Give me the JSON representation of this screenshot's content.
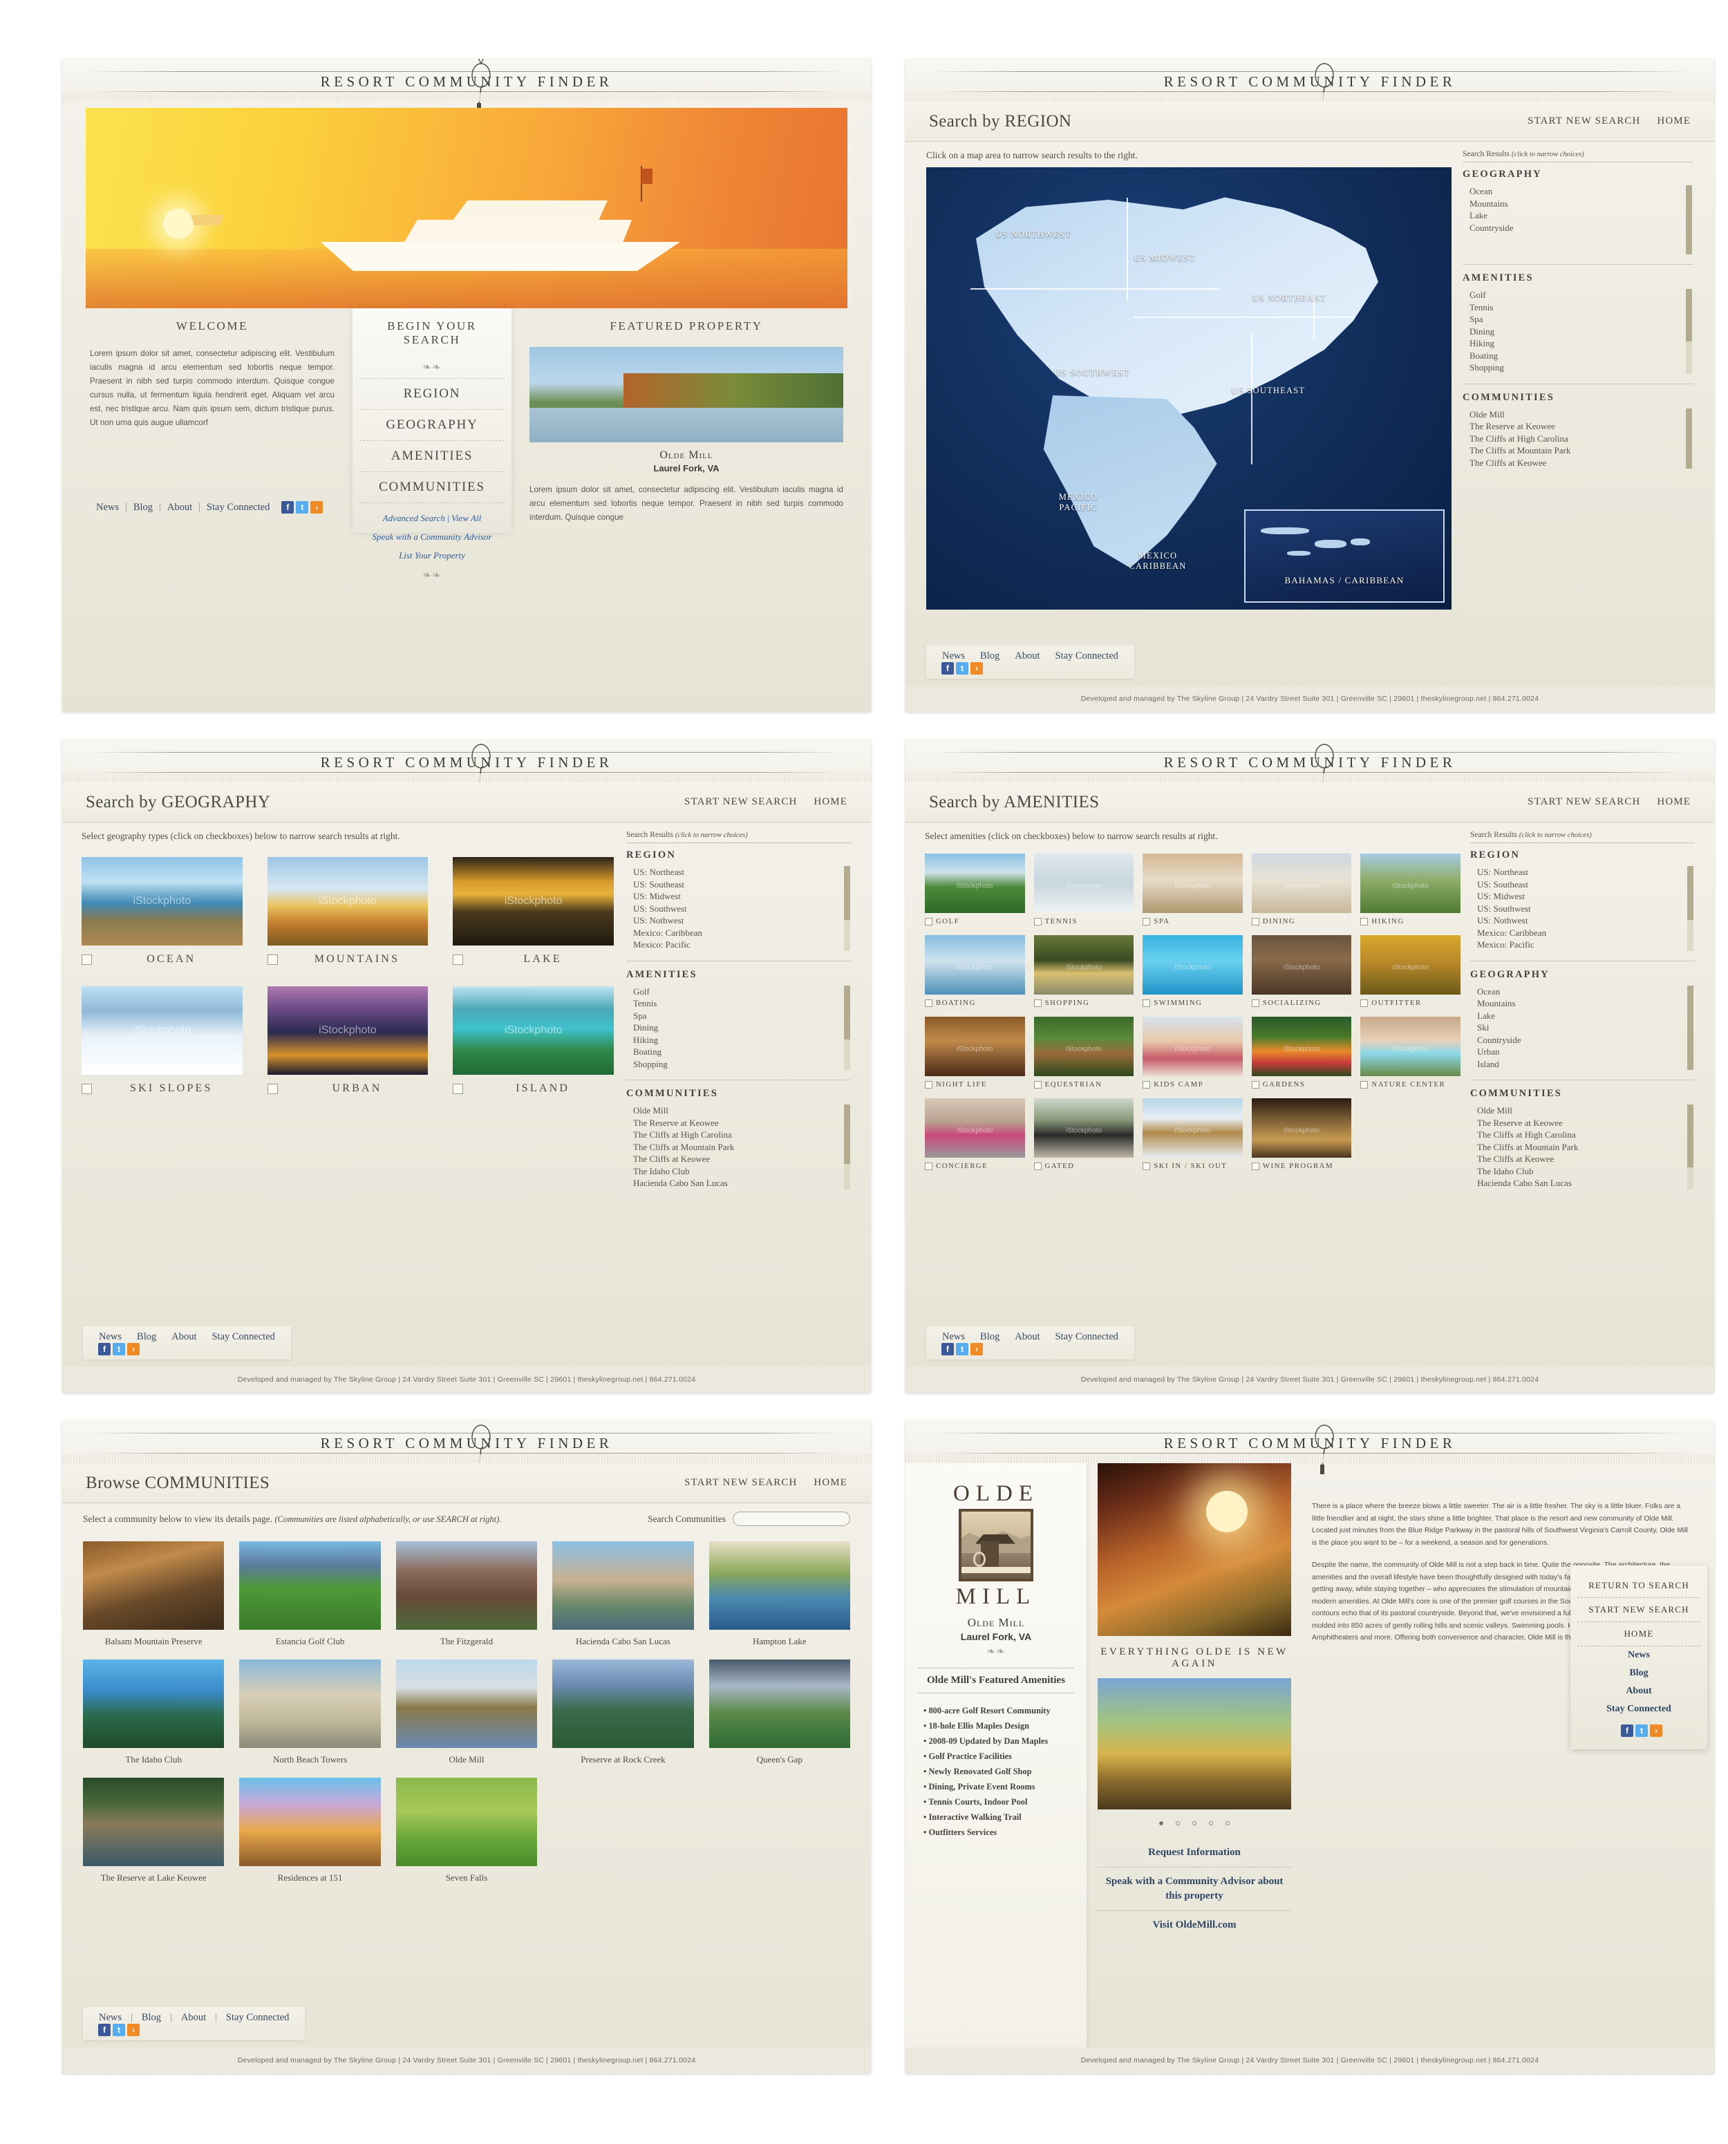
{
  "brand": {
    "title": "RESORT COMMUNITY FINDER"
  },
  "footer": {
    "credit": "Developed and managed by The Skyline Group  |  24 Vardry Street  Suite 301  |  Greenville  SC   |  29601  |  theskylinegroup.net  |  864.271.0024"
  },
  "footlinks": {
    "news": "News",
    "blog": "Blog",
    "about": "About",
    "stay": "Stay Connected",
    "sep": "|"
  },
  "home": {
    "welcome_title": "WELCOME",
    "welcome_text": "Lorem ipsum dolor sit amet, consectetur adipiscing elit. Vestibulum iaculis magna id arcu elementum sed lobortis neque tempor. Praesent in nibh sed turpis commodo interdum. Quisque congue cursus nulla, ut fermentum ligula hendrerit eget. Aliquam vel arcu est, nec tristique arcu. Nam quis ipsum sem, dictum tristique purus. Ut non urna quis augue ullamcorf",
    "search_title": "BEGIN YOUR SEARCH",
    "menu": [
      "REGION",
      "GEOGRAPHY",
      "AMENITIES",
      "COMMUNITIES"
    ],
    "advanced_search": "Advanced Search",
    "view_all": "View All",
    "link_sep": "|",
    "speak": "Speak with a Community Advisor",
    "list_property": "List Your Property",
    "feature_title": "FEATURED PROPERTY",
    "feature_name": "Olde Mill",
    "feature_loc": "Laurel Fork, VA",
    "feature_text": "Lorem ipsum dolor sit amet, consectetur adipiscing elit. Vestibulum iaculis magna id arcu elementum sed lobortis neque tempor. Praesent in nibh sed turpis commodo interdum. Quisque congue"
  },
  "region": {
    "page_title": "Search by REGION",
    "start_new": "START NEW SEARCH",
    "home": "HOME",
    "instruction": "Click on a map area to narrow search results to the right.",
    "results_label": "Search Results",
    "results_hint": "(click to narrow choices)",
    "map_labels": [
      "US NORTHWEST",
      "US MIDWEST",
      "US NORTHEAST",
      "US SOUTHWEST",
      "US SOUTHEAST",
      "MEXICO\nPACIFIC",
      "MEXICO\nCARIBBEAN"
    ],
    "inset_label": "BAHAMAS / CARIBBEAN",
    "sidebar": [
      {
        "title": "GEOGRAPHY",
        "items": [
          "Ocean",
          "Mountains",
          "Lake",
          "Countryside"
        ]
      },
      {
        "title": "AMENITIES",
        "items": [
          "Golf",
          "Tennis",
          "Spa",
          "Dining",
          "Hiking",
          "Boating",
          "Shopping"
        ]
      },
      {
        "title": "COMMUNITIES",
        "items": [
          "Olde Mill",
          "The Reserve at Keowee",
          "The Cliffs at High Carolina",
          "The Cliffs at Mountain Park",
          "The Cliffs at Keowee"
        ]
      }
    ]
  },
  "geography": {
    "page_title": "Search by GEOGRAPHY",
    "start_new": "START NEW SEARCH",
    "home": "HOME",
    "instruction": "Select geography types (click on checkboxes) below to narrow search results at right.",
    "results_label": "Search Results",
    "results_hint": "(click to narrow choices)",
    "watermark": "iStockphoto",
    "tiles": [
      "OCEAN",
      "MOUNTAINS",
      "LAKE",
      "SKI SLOPES",
      "URBAN",
      "ISLAND"
    ],
    "sidebar": [
      {
        "title": "REGION",
        "items": [
          "US: Northeast",
          "US: Southeast",
          "US: Midwest",
          "US: Southwest",
          "US: Nothwest",
          "Mexico: Caribbean",
          "Mexico: Pacific"
        ]
      },
      {
        "title": "AMENITIES",
        "items": [
          "Golf",
          "Tennis",
          "Spa",
          "Dining",
          "Hiking",
          "Boating",
          "Shopping"
        ]
      },
      {
        "title": "COMMUNITIES",
        "items": [
          "Olde Mill",
          "The Reserve at Keowee",
          "The Cliffs at High Carolina",
          "The Cliffs at Mountain Park",
          "The Cliffs at Keowee",
          "The Idaho Club",
          "Hacienda Cabo San Lucas"
        ]
      }
    ]
  },
  "amenities": {
    "page_title": "Search by AMENITIES",
    "start_new": "START NEW SEARCH",
    "home": "HOME",
    "instruction": "Select amenities (click on checkboxes) below to narrow search results at right.",
    "results_label": "Search Results",
    "results_hint": "(click to narrow choices)",
    "watermark": "iStockphoto",
    "tiles": [
      "GOLF",
      "TENNIS",
      "SPA",
      "DINING",
      "HIKING",
      "BOATING",
      "SHOPPING",
      "SWIMMING",
      "SOCIALIZING",
      "OUTFITTER",
      "NIGHT LIFE",
      "EQUESTRIAN",
      "KIDS CAMP",
      "GARDENS",
      "NATURE CENTER",
      "CONCIERGE",
      "GATED",
      "SKI IN / SKI OUT",
      "WINE PROGRAM"
    ],
    "sidebar": [
      {
        "title": "REGION",
        "items": [
          "US: Northeast",
          "US: Southeast",
          "US: Midwest",
          "US: Southwest",
          "US: Nothwest",
          "Mexico: Caribbean",
          "Mexico: Pacific"
        ]
      },
      {
        "title": "GEOGRAPHY",
        "items": [
          "Ocean",
          "Mountains",
          "Lake",
          "Ski",
          "Countryside",
          "Urban",
          "Island"
        ]
      },
      {
        "title": "COMMUNITIES",
        "items": [
          "Olde Mill",
          "The Reserve at Keowee",
          "The Cliffs at High Carolina",
          "The Cliffs at Mountain Park",
          "The Cliffs at Keowee",
          "The Idaho Club",
          "Hacienda Cabo San Lucas"
        ]
      }
    ]
  },
  "communities": {
    "page_title": "Browse COMMUNITIES",
    "start_new": "START NEW SEARCH",
    "home": "HOME",
    "instruction": "Select a community below to view its details page.",
    "instruction_note": "(Communities are listed alphabetically, or use SEARCH at right).",
    "search_label": "Search Communities",
    "search_value": "",
    "search_placeholder": "",
    "items": [
      "Balsam Mountain Preserve",
      "Estancia Golf Club",
      "The Fitzgerald",
      "Hacienda Cabo San Lucas",
      "Hampton Lake",
      "The Idaho Club",
      "North Beach Towers",
      "Olde Mill",
      "Preserve at Rock Creek",
      "Queen's Gap",
      "The Reserve at Lake Keowee",
      "Residences at 151",
      "Seven Falls"
    ]
  },
  "detail": {
    "logo_word1": "OLDE",
    "logo_word2": "MILL",
    "name": "Olde Mill",
    "loc": "Laurel Fork, VA",
    "amen_heading": "Olde Mill's Featured Amenities",
    "amenities": [
      "800-acre Golf Resort Community",
      "18-hole Ellis Maples Design",
      "2008-09 Updated by Dan Maples",
      "Golf Practice Facilities",
      "Newly Renovated Golf Shop",
      "Dining, Private Event Rooms",
      "Tennis Courts, Indoor Pool",
      "Interactive Walking Trail",
      "Outfitters Services"
    ],
    "tagline": "EVERYTHING OLDE IS NEW AGAIN",
    "cta_request": "Request Information",
    "cta_speak": "Speak with a Community Advisor about this property",
    "cta_visit": "Visit OldeMill.com",
    "body1": "There is a place where the breeze blows a little sweeter. The air is a little fresher. The sky is a little bluer. Folks are a little friendlier and at night, the stars shine a little brighter. That place is the resort and new community of Olde Mill. Located just minutes from the Blue Ridge Parkway in the pastoral hills of Southwest Virginia's Carroll County, Olde Mill is the place you want to be – for a weekend, a season and for generations.",
    "body2": "Despite the name, the community of Olde Mill is not a step back in time. Quite the opposite. The architecture, the amenities and the overall lifestyle have been thoughtfully designed with today's family in mind. The family who enjoys getting away, while staying together – who appreciates the stimulation of mountain country and the convenience of modern amenities. At Olde Mill's core is one of the premier golf courses in the Southeast. Designed by Ellis Maples, its contours echo that of its pastoral countryside. Beyond that, we've envisioned a fully-integrated community masterfully molded into 850 acres of gently rolling hills and scenic valleys. Swimming pools. Hiking trails. Sports fields. Amphitheaters and more. Offering both convenience and character, Olde Mill is the living definition of rural chic.",
    "nav": {
      "return": "RETURN TO SEARCH",
      "start_new": "START NEW SEARCH",
      "home": "HOME"
    }
  }
}
